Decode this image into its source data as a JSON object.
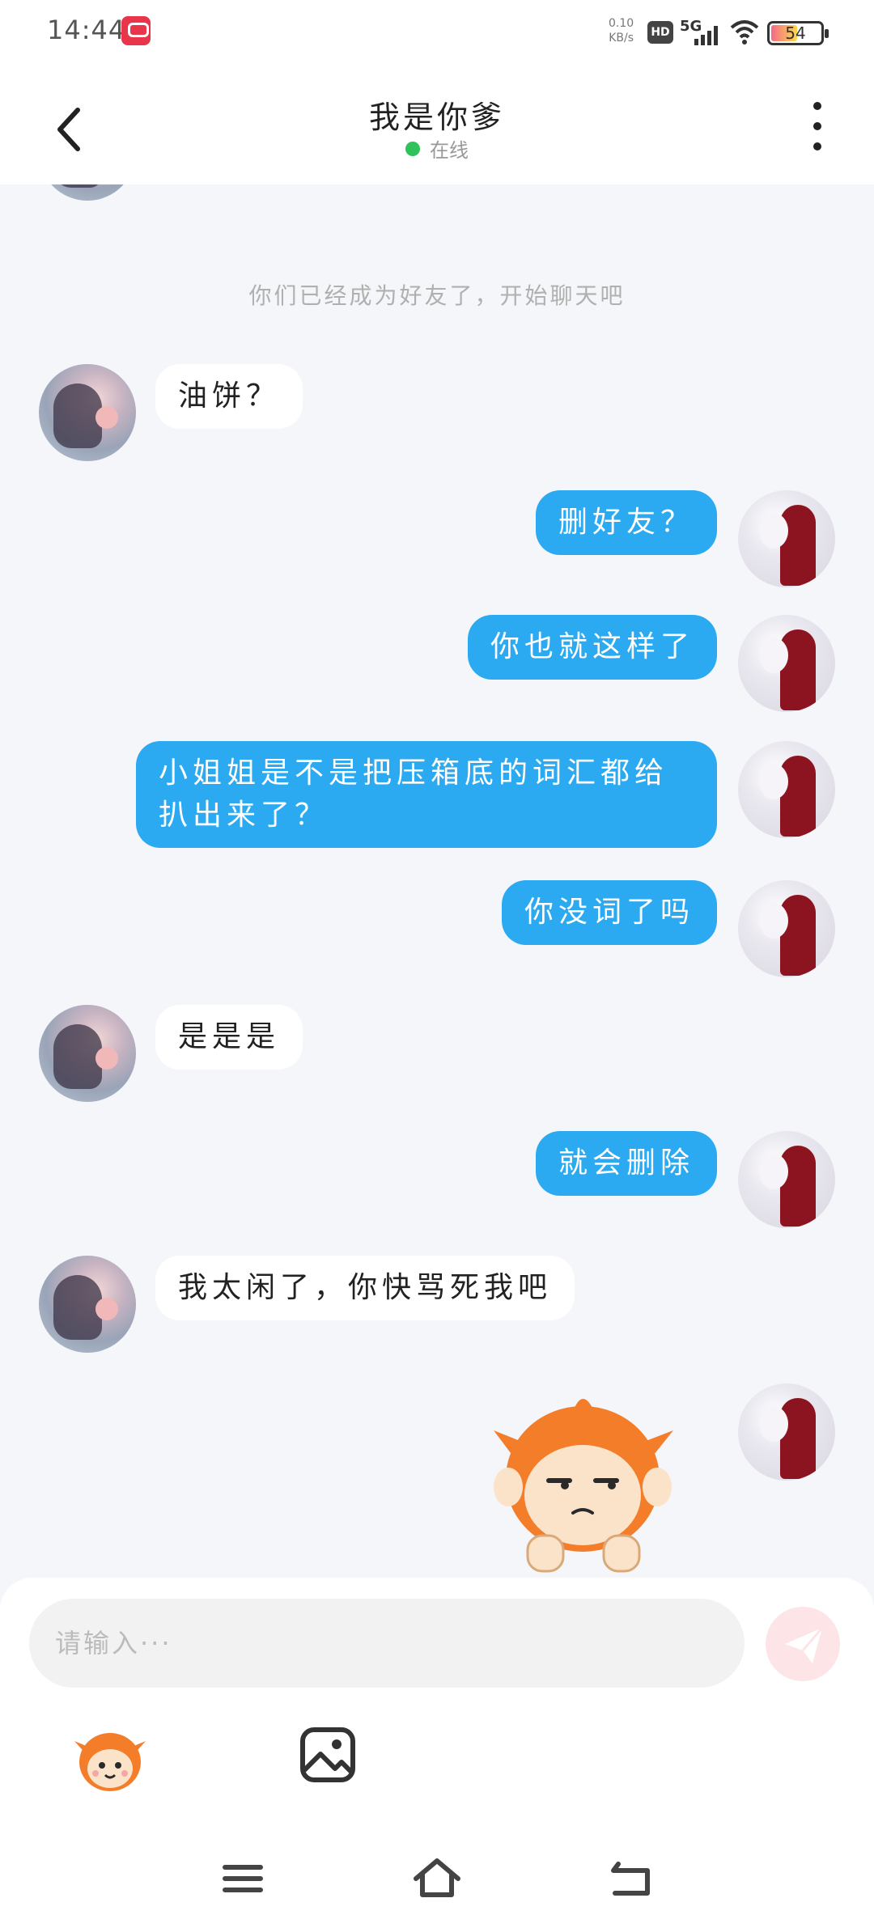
{
  "status_bar": {
    "time": "14:44",
    "net_speed_value": "0.10",
    "net_speed_unit": "KB/s",
    "hd_label": "HD",
    "network": "5G",
    "battery": "54",
    "battery_level": 0.54
  },
  "header": {
    "title": "我是你爹",
    "status": "在线",
    "status_color": "#2fc25b"
  },
  "chat": {
    "system_note": "你们已经成为好友了，开始聊天吧",
    "messages": [
      {
        "from": "other",
        "text": "油饼？"
      },
      {
        "from": "me",
        "text": "删好友？"
      },
      {
        "from": "me",
        "text": "你也就这样了"
      },
      {
        "from": "me",
        "text": "小姐姐是不是把压箱底的词汇都给扒出来了？"
      },
      {
        "from": "me",
        "text": "你没词了吗"
      },
      {
        "from": "other",
        "text": "是是是"
      },
      {
        "from": "me",
        "text": "就会删除"
      },
      {
        "from": "other",
        "text": "我太闲了，你快骂死我吧"
      },
      {
        "from": "me",
        "text": "",
        "sticker": "annoyed-monkey-sticker"
      }
    ]
  },
  "input": {
    "placeholder": "请输入···",
    "send_icon": "paper-plane-icon",
    "emoji_icon": "monkey-emoji-icon",
    "image_icon": "image-icon"
  },
  "nav": {
    "menu_icon": "menu-icon",
    "home_icon": "home-icon",
    "back_icon": "back-icon"
  },
  "colors": {
    "bubble_me": "#2baaf2",
    "bubble_other": "#ffffff",
    "background": "#f4f6f9"
  }
}
